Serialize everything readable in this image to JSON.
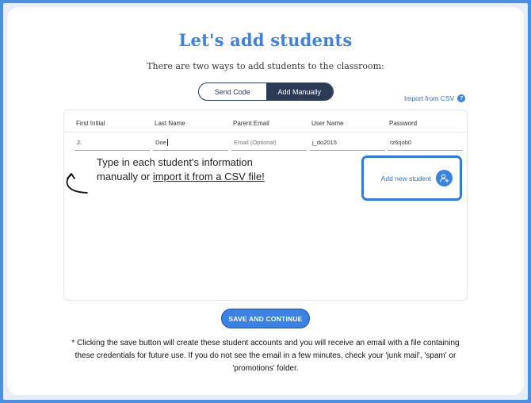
{
  "header": {
    "title": "Let's add students",
    "subtitle": "There are two ways to add students to the classroom:"
  },
  "mode_toggle": {
    "options": [
      "Send Code",
      "Add Manually"
    ],
    "selected": "Add Manually"
  },
  "import_link": {
    "label": "Import from CSV",
    "help_glyph": "?"
  },
  "table": {
    "columns": [
      "First Initial",
      "Last Name",
      "Parent Email",
      "User Name",
      "Password"
    ],
    "row": {
      "first_initial": "J.",
      "last_name": "Doe",
      "parent_email_placeholder": "Email (Optional)",
      "user_name": "j_do2015",
      "password": "rz6rjob0"
    }
  },
  "hint": {
    "text_before": "Type in each student's information manually or ",
    "link_text": "import it from a CSV file!"
  },
  "add_student": {
    "label": "Add new student",
    "icon": "user-plus-icon"
  },
  "save_button": {
    "label": "SAVE AND CONTINUE"
  },
  "footnote": "* Clicking the save button will create these student accounts and you will receive an email with a file containing these credentials for future use. If you do not see the email in a few minutes, check your 'junk mail', 'spam' or 'promotions' folder.",
  "colors": {
    "accent": "#3b82e6",
    "navy": "#2b3a55",
    "link": "#2f6fd6",
    "frame": "#4a90e2"
  }
}
